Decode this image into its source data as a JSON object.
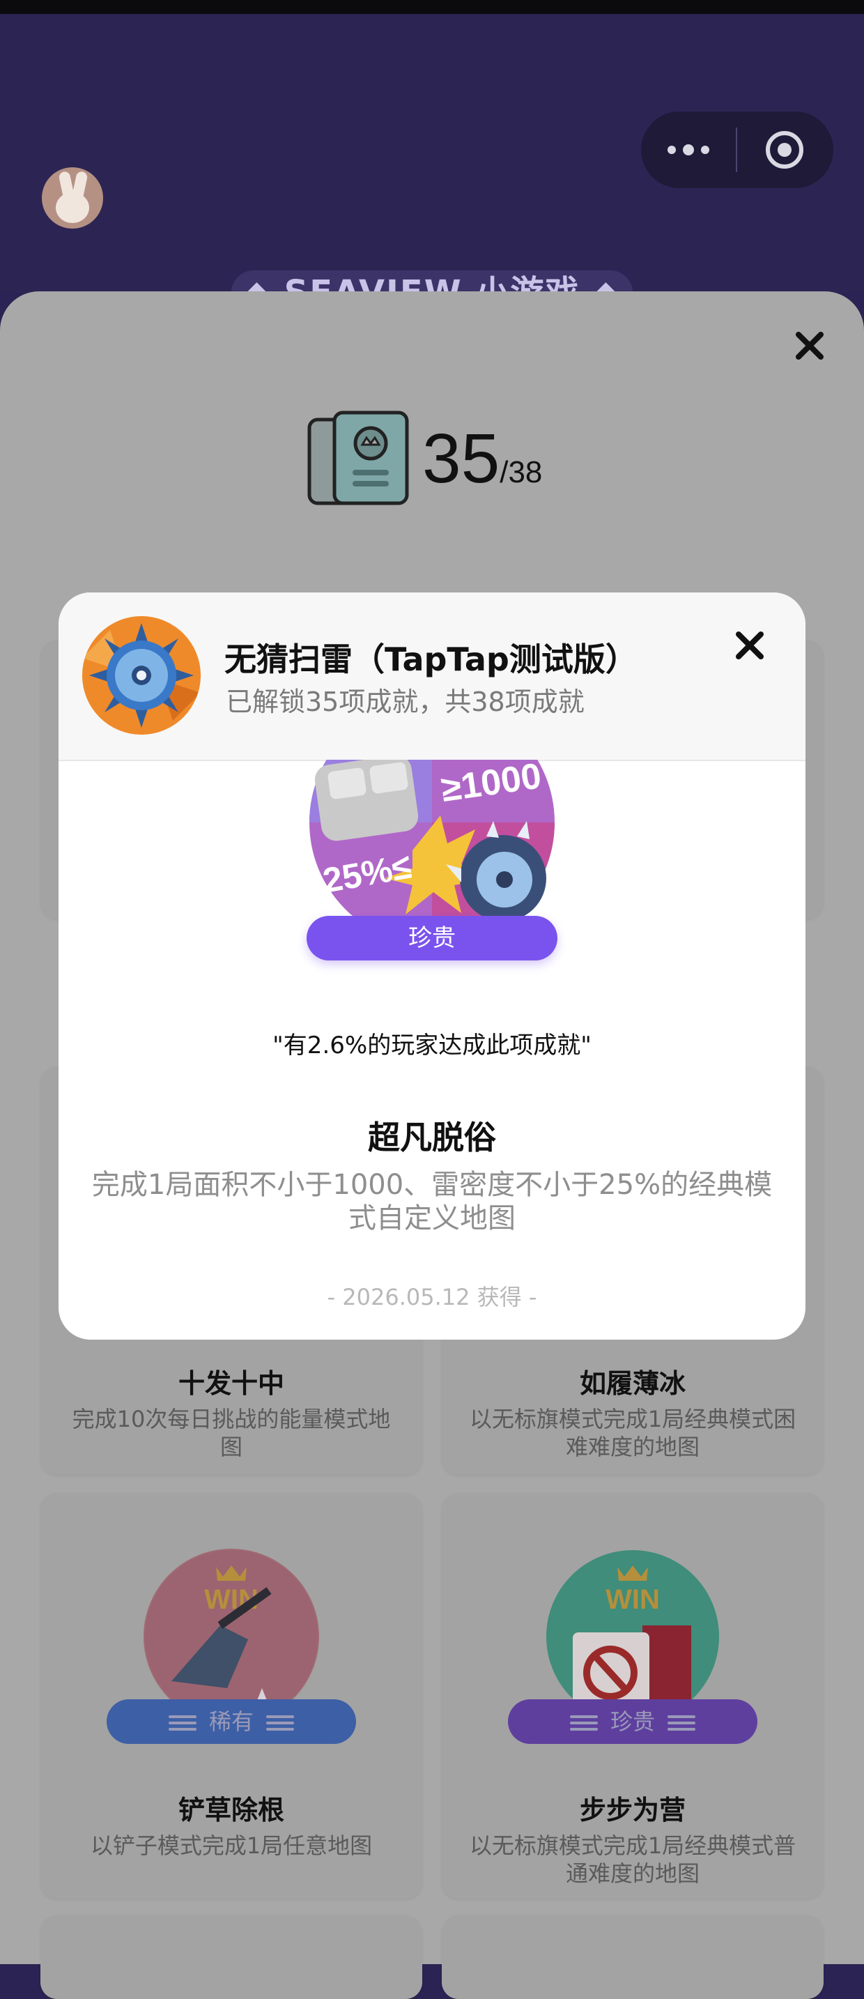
{
  "header": {
    "brand": "◆ SEAVIEW 小游戏 ◆"
  },
  "panel": {
    "unlocked": "35",
    "total": "/38"
  },
  "cards": [
    {
      "title": "十发十中",
      "desc": "完成10次每日挑战的能量模式地图"
    },
    {
      "title": "如履薄冰",
      "desc": "以无标旗模式完成1局经典模式困难难度的地图"
    },
    {
      "title": "铲草除根",
      "desc": "以铲子模式完成1局任意地图",
      "rarity": "稀有"
    },
    {
      "title": "步步为营",
      "desc": "以无标旗模式完成1局经典模式普通难度的地图",
      "rarity": "珍贵"
    }
  ],
  "modal": {
    "game_title": "无猜扫雷（TapTap测试版）",
    "game_sub": "已解锁35项成就，共38项成就",
    "badge_text_top": "≥1000",
    "badge_text_left": "25%≤",
    "rarity": "珍贵",
    "stat": "\"有2.6%的玩家达成此项成就\"",
    "name": "超凡脱俗",
    "desc": "完成1局面积不小于1000、雷密度不小于25%的经典模式自定义地图",
    "date": "- 2026.05.12 获得 -"
  },
  "colors": {
    "accent": "#7a53ee",
    "rare": "#3d63c9",
    "background_top": "#2c2554"
  }
}
